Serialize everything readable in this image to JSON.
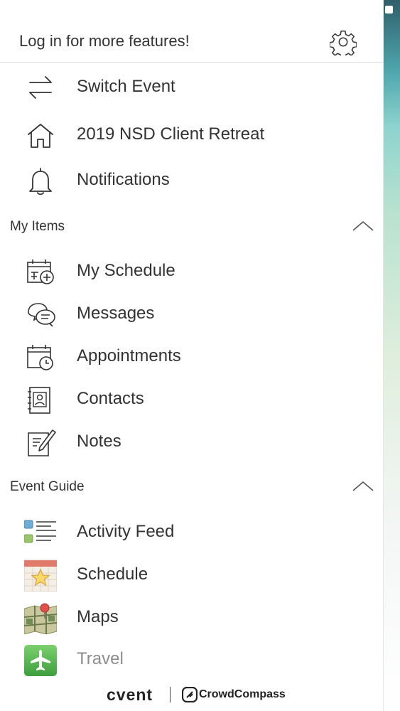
{
  "header": {
    "title": "Log in for more features!"
  },
  "top_items": [
    {
      "label": "Switch Event",
      "icon": "switch-arrows-icon"
    },
    {
      "label": "2019 NSD Client Retreat",
      "icon": "home-icon"
    },
    {
      "label": "Notifications",
      "icon": "bell-icon"
    }
  ],
  "my_items": {
    "title": "My Items",
    "items": [
      {
        "label": "My Schedule",
        "icon": "calendar-add-icon"
      },
      {
        "label": "Messages",
        "icon": "chat-bubbles-icon"
      },
      {
        "label": "Appointments",
        "icon": "calendar-clock-icon"
      },
      {
        "label": "Contacts",
        "icon": "contact-book-icon"
      },
      {
        "label": "Notes",
        "icon": "note-pencil-icon"
      }
    ]
  },
  "event_guide": {
    "title": "Event Guide",
    "items": [
      {
        "label": "Activity Feed",
        "icon": "activity-feed-icon"
      },
      {
        "label": "Schedule",
        "icon": "schedule-star-icon"
      },
      {
        "label": "Maps",
        "icon": "map-pin-icon"
      },
      {
        "label": "Travel",
        "icon": "airplane-icon"
      }
    ]
  },
  "footer": {
    "brand1": "cvent",
    "brand2": "CrowdCompass"
  }
}
